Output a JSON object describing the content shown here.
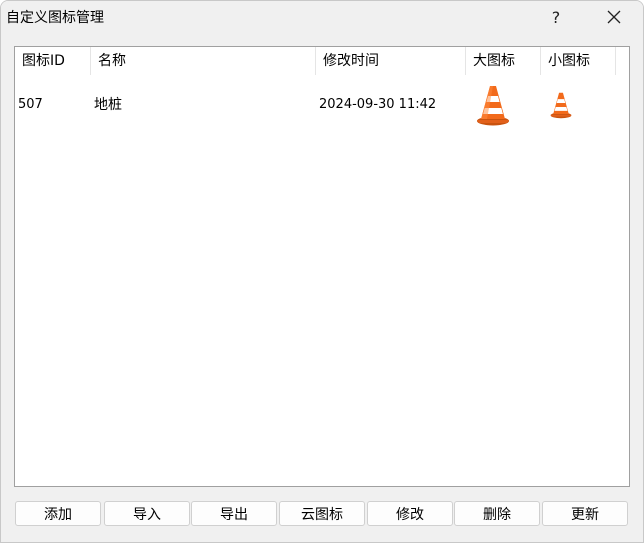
{
  "window": {
    "title": "自定义图标管理",
    "help_label": "?"
  },
  "table": {
    "columns": [
      "图标ID",
      "名称",
      "修改时间",
      "大图标",
      "小图标"
    ],
    "rows": [
      {
        "id": "507",
        "name": "地桩",
        "modified": "2024-09-30 11:42",
        "large_icon": "traffic-cone-icon",
        "small_icon": "traffic-cone-icon"
      }
    ]
  },
  "buttons": {
    "add": "添加",
    "import": "导入",
    "export": "导出",
    "cloud_icon": "云图标",
    "edit": "修改",
    "delete": "删除",
    "update": "更新"
  },
  "colors": {
    "cone_orange": "#f26a1b",
    "cone_white": "#ffffff"
  }
}
